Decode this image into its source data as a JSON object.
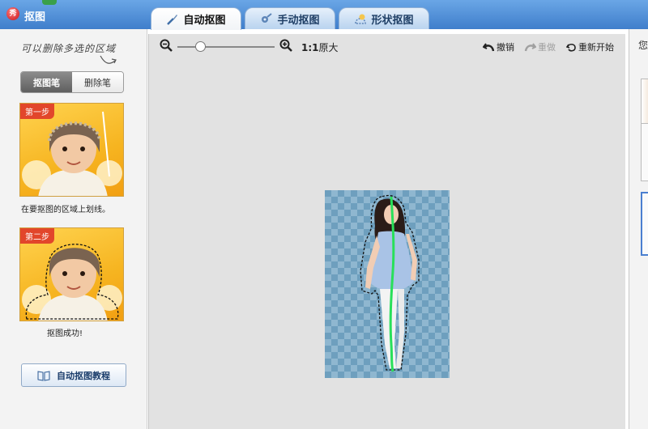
{
  "window": {
    "title": "抠图",
    "logo_text": "秀"
  },
  "tabs": [
    {
      "label": "自动抠图",
      "icon": "brush-icon",
      "active": true
    },
    {
      "label": "手动抠图",
      "icon": "gear-brush-icon",
      "active": false
    },
    {
      "label": "形状抠图",
      "icon": "shape-icon",
      "active": false
    }
  ],
  "left_panel": {
    "hint": "可以删除多选的区域",
    "pens": [
      {
        "label": "抠图笔",
        "active": true
      },
      {
        "label": "删除笔",
        "active": false
      }
    ],
    "steps": [
      {
        "badge": "第一步",
        "caption": "在要抠图的区域上划线。"
      },
      {
        "badge": "第二步",
        "caption": "抠图成功!"
      }
    ],
    "tutorial_button": "自动抠图教程"
  },
  "toolbar": {
    "ratio_bold": "1:1",
    "ratio_text": "原大",
    "zoom_level": 0.2,
    "undo": "撤销",
    "redo": "重做",
    "restart": "重新开始"
  },
  "right_panel": {
    "partial_text": "您"
  },
  "colors": {
    "title_bar": "#3f7ecb",
    "selection_stroke": "#28e05a",
    "step_badge": "#e2462b",
    "checker_dark": "#6e9fbe",
    "checker_light": "#8fb7d0"
  }
}
